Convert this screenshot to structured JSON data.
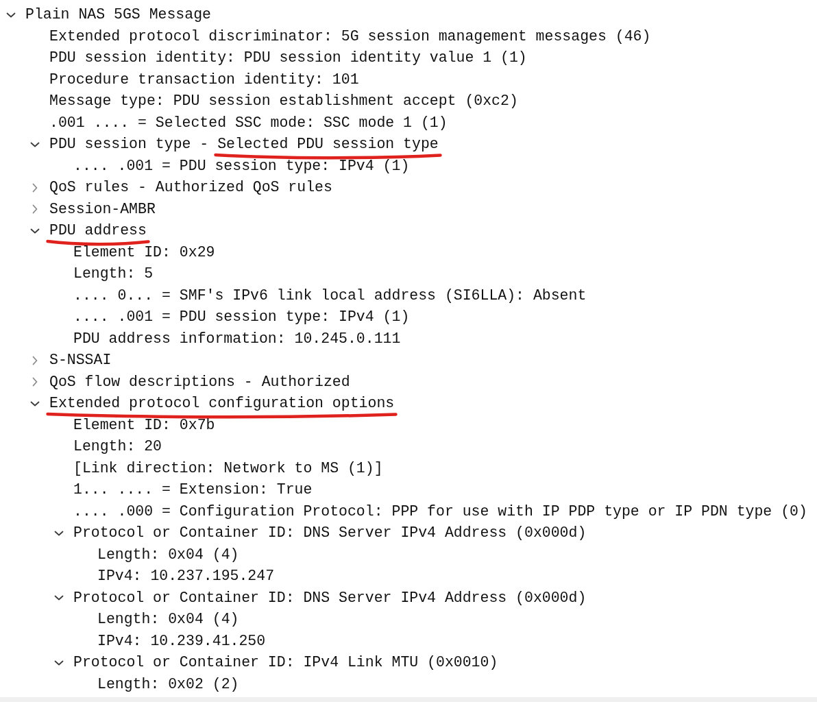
{
  "tree": [
    {
      "label": "Plain NAS 5GS Message",
      "expanded": true,
      "children": [
        {
          "label": "Extended protocol discriminator: 5G session management messages (46)"
        },
        {
          "label": "PDU session identity: PDU session identity value 1 (1)"
        },
        {
          "label": "Procedure transaction identity: 101"
        },
        {
          "label": "Message type: PDU session establishment accept (0xc2)"
        },
        {
          "label": ".001 .... = Selected SSC mode: SSC mode 1 (1)"
        },
        {
          "parts": [
            {
              "text": "PDU session type -",
              "marked": false
            },
            {
              "text": "Selected PDU session type",
              "marked": true
            }
          ],
          "expanded": true,
          "children": [
            {
              "label": ".... .001 = PDU session type: IPv4 (1)"
            }
          ]
        },
        {
          "label": "QoS rules - Authorized QoS rules",
          "expanded": false
        },
        {
          "label": "Session-AMBR",
          "expanded": false
        },
        {
          "parts": [
            {
              "text": "PDU address",
              "marked": true
            }
          ],
          "expanded": true,
          "children": [
            {
              "label": "Element ID: 0x29"
            },
            {
              "label": "Length: 5"
            },
            {
              "label": ".... 0... = SMF's IPv6 link local address (SI6LLA): Absent"
            },
            {
              "label": ".... .001 = PDU session type: IPv4 (1)"
            },
            {
              "label": "PDU address information: 10.245.0.111"
            }
          ]
        },
        {
          "label": "S-NSSAI",
          "expanded": false
        },
        {
          "label": "QoS flow descriptions - Authorized",
          "expanded": false
        },
        {
          "parts": [
            {
              "text": "Extended protocol configuration options",
              "marked": true
            }
          ],
          "expanded": true,
          "children": [
            {
              "label": "Element ID: 0x7b"
            },
            {
              "label": "Length: 20"
            },
            {
              "label": "[Link direction: Network to MS (1)]"
            },
            {
              "label": "1... .... = Extension: True"
            },
            {
              "label": ".... .000 = Configuration Protocol: PPP for use with IP PDP type or IP PDN type (0)"
            },
            {
              "label": "Protocol or Container ID: DNS Server IPv4 Address (0x000d)",
              "expanded": true,
              "children": [
                {
                  "label": "Length: 0x04 (4)"
                },
                {
                  "label": "IPv4: 10.237.195.247"
                }
              ]
            },
            {
              "label": "Protocol or Container ID: DNS Server IPv4 Address (0x000d)",
              "expanded": true,
              "children": [
                {
                  "label": "Length: 0x04 (4)"
                },
                {
                  "label": "IPv4: 10.239.41.250"
                }
              ]
            },
            {
              "label": "Protocol or Container ID: IPv4 Link MTU (0x0010)",
              "expanded": true,
              "children": [
                {
                  "label": "Length: 0x02 (2)"
                }
              ]
            }
          ]
        }
      ]
    }
  ]
}
